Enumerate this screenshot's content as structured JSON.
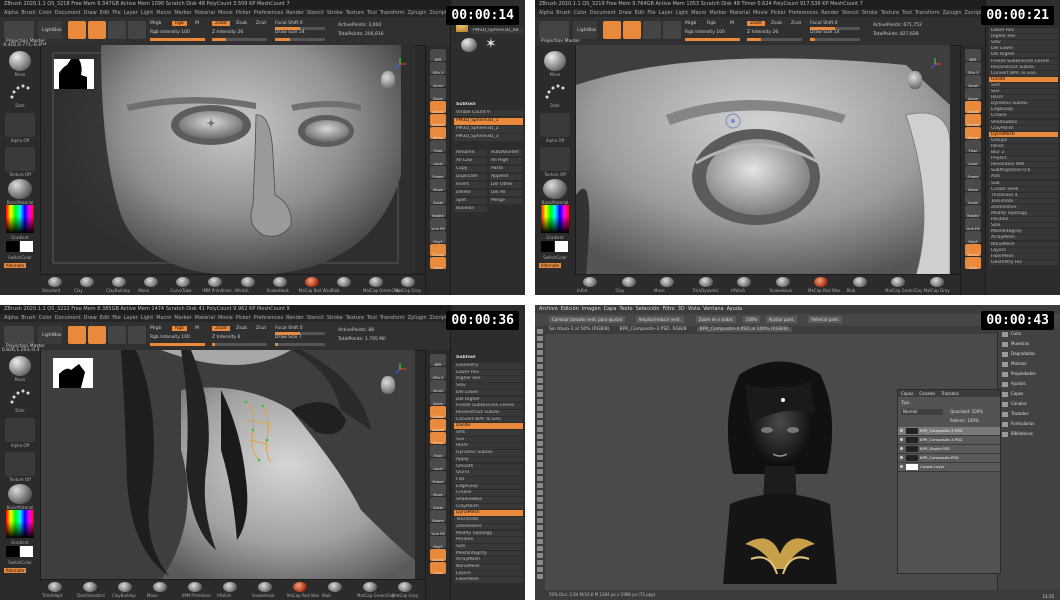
{
  "panels": [
    {
      "timestamp": "00:00:14",
      "title_bar": "ZBrush 2020.1.1   QS_3218   Free Mem 9.347GB   Active Mem 1090   Scratch Disk 48   PolyCount 3.509 KP   MeshCount 7",
      "menus": [
        "Alpha",
        "Brush",
        "Color",
        "Document",
        "Draw",
        "Edit",
        "File",
        "Layer",
        "Light",
        "Macro",
        "Marker",
        "Material",
        "Movie",
        "Picker",
        "Preferences",
        "Render",
        "Stencil",
        "Stroke",
        "Texture",
        "Tool",
        "Transform",
        "Zplugin",
        "Zscript",
        "Help"
      ],
      "quicksave": "QuickSave",
      "toolbar": {
        "lightbox": "LightBox",
        "projection": "Projection Master",
        "mrgb": "Mrgb",
        "rgb": "Rgb",
        "m": "M",
        "zadd": "Zadd",
        "zsub": "Zsub",
        "zcut": "Zcut",
        "rgb_intensity": "Rgb Intensity 100",
        "z_intensity": "Z Intensity 26",
        "focal_shift": "Focal Shift 0",
        "draw_size": "Draw Size 54",
        "active_points": "ActivePoints: 3,004",
        "total_points": "TotalPoints: 206,816"
      },
      "coords": "-0.402,0.771,-0.404",
      "left_tray": {
        "brush": "Move",
        "stroke": "Dots",
        "alpha": "Alpha Off",
        "texture": "Texture Off",
        "material": "BasicMaterial",
        "gradient": "Gradient",
        "switch": "SwitchColor",
        "alternate": "Alternate"
      },
      "tool_panel": {
        "title": "SimpleBrush",
        "current_tool": "PM3D_Sphere3D_48",
        "subtool_header": "Subtool",
        "visible_count": "Visible Count 9",
        "subtools": [
          "PM3D_Sphere3D_1",
          "PM3D_Sphere3D_2",
          "PM3D_Sphere3D_3"
        ],
        "buttons": [
          "Rename",
          "AutoReorder",
          "All Low",
          "All High",
          "Copy",
          "Paste",
          "Duplicate",
          "Append",
          "Insert",
          "Del Other",
          "Delete",
          "Del All",
          "Split",
          "Merge",
          "Boolean"
        ]
      },
      "bottom_brushes": [
        "Standard",
        "Clay",
        "ClayBuildup",
        "Move",
        "CurveTube",
        "IMM Primitives",
        "hPolish",
        "SnakeHook",
        "MaCap Red Wax",
        "Blob",
        "MatCap GreenClay",
        "MatCap Gray"
      ],
      "right_icons": [
        "BPR",
        "SPix 3",
        "Scroll",
        "Zoom",
        "Actual",
        "AAHalf",
        "Persp",
        "Floor",
        "Local",
        "Frame",
        "Move",
        "Scale",
        "Rotate",
        "Line Fill",
        "PolyF",
        "Transp",
        "Solo"
      ]
    },
    {
      "timestamp": "00:00:21",
      "title_bar": "ZBrush 2020.1.1   QS_3219   Free Mem 9.764GB   Active Mem 1053   Scratch Disk 48   Timer 0.624   PolyCount 917.536 KP   MeshCount 7",
      "menus": [
        "Alpha",
        "Brush",
        "Color",
        "Document",
        "Draw",
        "Edit",
        "File",
        "Layer",
        "Light",
        "Macro",
        "Marker",
        "Material",
        "Movie",
        "Picker",
        "Preferences",
        "Render",
        "Stencil",
        "Stroke",
        "Texture",
        "Tool",
        "Transform",
        "Zplugin",
        "Zscript",
        "Help"
      ],
      "quicksave": "QuickSave",
      "toolbar": {
        "lightbox": "LightBox",
        "projection": "Projection Master",
        "mrgb": "Mrgb",
        "rgb": "Rgb",
        "m": "M",
        "zadd": "Zadd",
        "zsub": "Zsub",
        "zcut": "Zcut",
        "rgb_intensity": "Rgb Intensity 100",
        "z_intensity": "Z Intensity 26",
        "focal_shift": "Focal Shift 0",
        "draw_size": "Draw Size 14",
        "active_points": "ActivePoints: 671,752",
        "total_points": "TotalPoints: 827,628"
      },
      "coords": "",
      "left_tray": {
        "brush": "Move",
        "stroke": "Dots",
        "alpha": "Alpha Off",
        "texture": "Texture Off",
        "material": "BasicMaterial",
        "gradient": "Gradient",
        "switch": "SwitchColor",
        "alternate": "Alternate"
      },
      "geometry_panel": {
        "header": "Geometry",
        "items": [
          "Lower Res",
          "Higher Res",
          "Sdiv",
          "Del Lower",
          "Del Higher",
          "Freeze SubDivision Levels",
          "Reconstruct Subdiv",
          "Convert BPR To Geo",
          "Divide",
          "Smt",
          "Suv",
          "ReUV",
          "Dynamic Subdiv",
          "EdgeLoop",
          "Crease",
          "ShadowBox",
          "ClayPolish",
          "DynaMesh",
          "Groups",
          "Polish",
          "Blur 2",
          "Project",
          "Resolution 896",
          "SubProjection 0.6",
          "Add",
          "Sub",
          "Create Shell",
          "Thickness 4",
          "Tessimate",
          "ZRemesher",
          "Modify Topology",
          "Position",
          "Size",
          "MeshIntegrity",
          "ArrayMesh",
          "NanoMesh",
          "Layers",
          "FiberMesh",
          "Geometry HD"
        ]
      },
      "bottom_brushes": [
        "Inflat",
        "Clay",
        "Move",
        "TrimDynamic",
        "hPolish",
        "SnakeHook",
        "MaCap Red Wax",
        "Blob",
        "MatCap GreenClay",
        "MatCap Gray"
      ],
      "right_icons": [
        "BPR",
        "SPix 3",
        "Scroll",
        "Zoom",
        "Actual",
        "AAHalf",
        "Persp",
        "Floor",
        "Local",
        "Frame",
        "Move",
        "Scale",
        "Rotate",
        "Line Fill",
        "PolyF",
        "Transp",
        "Solo"
      ]
    },
    {
      "timestamp": "00:00:36",
      "title_bar": "ZBrush 2020.1.1   QS_3222   Free Mem 8.385GB   Active Mem 1474   Scratch Disk 41   PolyCount 9.962 KP   MeshCount 9",
      "menus": [
        "Alpha",
        "Brush",
        "Color",
        "Document",
        "Draw",
        "Edit",
        "File",
        "Layer",
        "Light",
        "Macro",
        "Marker",
        "Material",
        "Movie",
        "Picker",
        "Preferences",
        "Render",
        "Stencil",
        "Stroke",
        "Texture",
        "Tool",
        "Transform",
        "Zplugin",
        "Zscript",
        "Help"
      ],
      "quicksave": "QuickSave",
      "toolbar": {
        "lightbox": "LightBox",
        "projection": "Projection Master",
        "mrgb": "Mrgb",
        "rgb": "Rgb",
        "m": "M",
        "zadd": "Zadd",
        "zsub": "Zsub",
        "zcut": "Zcut",
        "rgb_intensity": "Rgb Intensity 100",
        "z_intensity": "Z Intensity 6",
        "focal_shift": "Focal Shift 0",
        "draw_size": "Draw Size 7",
        "active_points": "ActivePoints: 88",
        "total_points": "TotalPoints: 1.795 Mil"
      },
      "coords": "0.826,1.203,-0.3",
      "left_tray": {
        "brush": "Move",
        "stroke": "Dots",
        "alpha": "Alpha Off",
        "texture": "Texture Off",
        "material": "BasicMaterial",
        "gradient": "Gradient",
        "switch": "SwitchColor",
        "alternate": "Alternate"
      },
      "geometry_panel": {
        "header": "Subtool",
        "items": [
          "Geometry",
          "Lower Res",
          "Higher Res",
          "Sdiv",
          "Del Lower",
          "Del Higher",
          "Freeze SubDivision Levels",
          "Reconstruct Subdiv",
          "Convert BPR To Geo",
          "Divide",
          "Smt",
          "Suv",
          "ReUV",
          "Dynamic Subdiv",
          "Apply",
          "Smooth",
          "QGrid",
          "Flat",
          "EdgeLoop",
          "Crease",
          "ShadowBox",
          "ClayPolish",
          "DynaMesh",
          "Tessimate",
          "ZRemesher",
          "Modify Topology",
          "Position",
          "Size",
          "MeshIntegrity",
          "ArrayMesh",
          "NanoMesh",
          "Layers",
          "FiberMesh"
        ]
      },
      "bottom_brushes": [
        "TrimAdapt",
        "DamStandard",
        "ClayBuildup",
        "Move",
        "IMM Primitives",
        "hPolish",
        "SnakeHook",
        "MaCap Red Wax",
        "Blob",
        "MatCap GreenClay",
        "MatCap Gray"
      ],
      "right_icons": [
        "BPR",
        "SPix 3",
        "Scroll",
        "Zoom",
        "Actual",
        "AAHalf",
        "Persp",
        "Floor",
        "Local",
        "Frame",
        "Move",
        "Scale",
        "Rotate",
        "Line Fill",
        "PolyF",
        "Transp",
        "Solo"
      ]
    },
    {
      "timestamp": "00:00:43",
      "menus": [
        "Archivo",
        "Edición",
        "Imagen",
        "Capa",
        "Texto",
        "Selección",
        "Filtro",
        "3D",
        "Vista",
        "Ventana",
        "Ayuda"
      ],
      "options": [
        "Cambiar tamaño vent. para ajustar",
        "Ampliar/reducir vent.",
        "Zoom en n todas",
        "100%",
        "Ajustar pant.",
        "Rellenar pant."
      ],
      "tabs": [
        "Sin título-1 al 50% (RGB/8)",
        "BPR_Composite-3.PSD, RGB/8",
        "BPR_Composite-4.PSD al 100% (RGB/8)"
      ],
      "side_panel": [
        "Color",
        "Muestras",
        "Degradados",
        "Motivos",
        "Propiedades",
        "Ajustes",
        "Capas",
        "Canales",
        "Trazados",
        "Formularios",
        "Bibliotecas"
      ],
      "layers_panel": {
        "tabs": [
          "Capas",
          "Canales",
          "Trazados"
        ],
        "kind": "Tipo",
        "blend": "Normal",
        "opacity": "Opacidad: 100%",
        "fill": "Relleno: 100%",
        "layers": [
          "BPR_Composite-3.PSD",
          "BPR_Composite-3.PSD",
          "BPR_Depth.PSD",
          "BPR_Composite.PSD",
          "Carpet Layer"
        ]
      },
      "status": "50%     Doc: 2,64 M/10,6 M     1364 px x 1968 px (72 ppp)",
      "clock": "13:15"
    }
  ],
  "colors": {
    "accent": "#e8893b",
    "zb_bg": "#2a2a2a",
    "ps_bg": "#535353"
  }
}
